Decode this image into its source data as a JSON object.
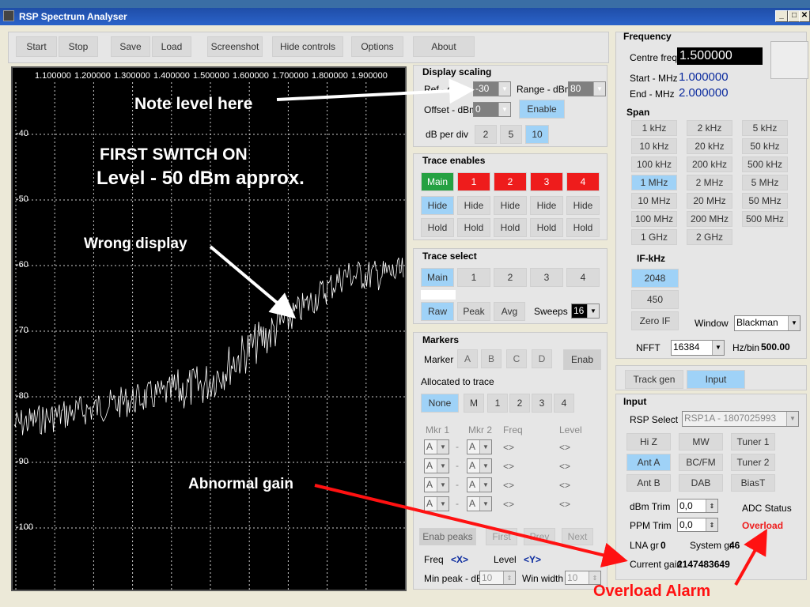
{
  "window": {
    "title": "RSP Spectrum Analyser"
  },
  "toolbar": {
    "start": "Start",
    "stop": "Stop",
    "save": "Save",
    "load": "Load",
    "screenshot": "Screenshot",
    "hide_controls": "Hide controls",
    "options": "Options",
    "about": "About"
  },
  "plot": {
    "freq_labels": [
      "1.100000",
      "1.200000",
      "1.300000",
      "1.400000",
      "1.500000",
      "1.600000",
      "1.700000",
      "1.800000",
      "1.900000"
    ],
    "db_labels": [
      "-40",
      "-50",
      "-60",
      "-70",
      "-80",
      "-90",
      "-100"
    ],
    "annotations": {
      "note_level": "Note level here",
      "first_switch": "FIRST SWITCH ON",
      "level_approx": "Level - 50 dBm approx.",
      "wrong_display": "Wrong display",
      "abnormal_gain": "Abnormal gain",
      "overload_alarm": "Overload Alarm"
    },
    "arrow_color": "#ff1111"
  },
  "display_scaling": {
    "title": "Display scaling",
    "ref_label": "Ref - dB",
    "ref_value": "-30",
    "range_label": "Range - dBm",
    "range_value": "80",
    "offset_label": "Offset - dBm",
    "offset_value": "0",
    "enable": "Enable",
    "dbdiv_label": "dB per div",
    "dbdiv": [
      "2",
      "5",
      "10"
    ]
  },
  "trace_enables": {
    "title": "Trace enables",
    "row1": [
      "Main",
      "1",
      "2",
      "3",
      "4"
    ],
    "row2": [
      "Hide",
      "Hide",
      "Hide",
      "Hide",
      "Hide"
    ],
    "row3": [
      "Hold",
      "Hold",
      "Hold",
      "Hold",
      "Hold"
    ]
  },
  "trace_select": {
    "title": "Trace select",
    "traces": [
      "Main",
      "1",
      "2",
      "3",
      "4"
    ],
    "modes": [
      "Raw",
      "Peak",
      "Avg"
    ],
    "sweeps_label": "Sweeps",
    "sweeps_value": "16"
  },
  "markers": {
    "title": "Markers",
    "marker_label": "Marker",
    "marker_buttons": [
      "A",
      "B",
      "C",
      "D"
    ],
    "enab": "Enab",
    "allocated_label": "Allocated to trace",
    "alloc_buttons": [
      "None",
      "M",
      "1",
      "2",
      "3",
      "4"
    ],
    "col_mkr1": "Mkr 1",
    "col_mkr2": "Mkr 2",
    "col_freq": "Freq",
    "col_level": "Level",
    "mkr_value": "A",
    "dash": "-",
    "diamond": "<>",
    "enab_peaks": "Enab peaks",
    "first": "First",
    "prev": "Prev",
    "next": "Next",
    "freq_label": "Freq",
    "freq_x": "<X>",
    "level_label": "Level",
    "level_y": "<Y>",
    "minpeak_label": "Min peak - dB",
    "minpeak_value": "10",
    "winwidth_label": "Win width",
    "winwidth_value": "10"
  },
  "frequency": {
    "title": "Frequency",
    "centre_label": "Centre freq",
    "centre_value": "1.500000",
    "start_label": "Start - MHz",
    "start_value": "1.000000",
    "end_label": "End - MHz",
    "end_value": "2.000000",
    "span_label": "Span",
    "spans": [
      [
        "1 kHz",
        "2 kHz",
        "5 kHz"
      ],
      [
        "10 kHz",
        "20 kHz",
        "50 kHz"
      ],
      [
        "100 kHz",
        "200 kHz",
        "500 kHz"
      ],
      [
        "1 MHz",
        "2 MHz",
        "5 MHz"
      ],
      [
        "10 MHz",
        "20 MHz",
        "50 MHz"
      ],
      [
        "100 MHz",
        "200 MHz",
        "500 MHz"
      ],
      [
        "1 GHz",
        "2 GHz",
        ""
      ]
    ],
    "if_label": "IF-kHz",
    "if_values": [
      "2048",
      "450",
      "Zero IF"
    ],
    "window_label": "Window",
    "window_value": "Blackman",
    "nfft_label": "NFFT",
    "nfft_value": "16384",
    "hzbin_label": "Hz/bin",
    "hzbin_value": "500.00"
  },
  "tabs": {
    "track_gen": "Track gen",
    "input": "Input"
  },
  "input": {
    "title": "Input",
    "rsp_label": "RSP Select",
    "rsp_value": "RSP1A - 1807025993",
    "ant_buttons": [
      [
        "Hi Z",
        "MW",
        "Tuner 1"
      ],
      [
        "Ant A",
        "BC/FM",
        "Tuner 2"
      ],
      [
        "Ant B",
        "DAB",
        "BiasT"
      ]
    ],
    "dbm_trim_label": "dBm Trim",
    "dbm_trim_value": "0,0",
    "ppm_trim_label": "PPM Trim",
    "ppm_trim_value": "0,0",
    "adc_status_label": "ADC Status",
    "adc_status_value": "Overload",
    "lna_label": "LNA gr",
    "lna_value": "0",
    "sysgr_label": "System gr",
    "sysgr_value": "46",
    "gain_label": "Current gain",
    "gain_value": "2147483649"
  },
  "colors": {
    "accent_blue": "#9fd2f7",
    "trace_red": "#ee1c1c",
    "main_green": "#25a142",
    "overload_red": "#ff0000",
    "value_blue": "#0a2a9e"
  }
}
